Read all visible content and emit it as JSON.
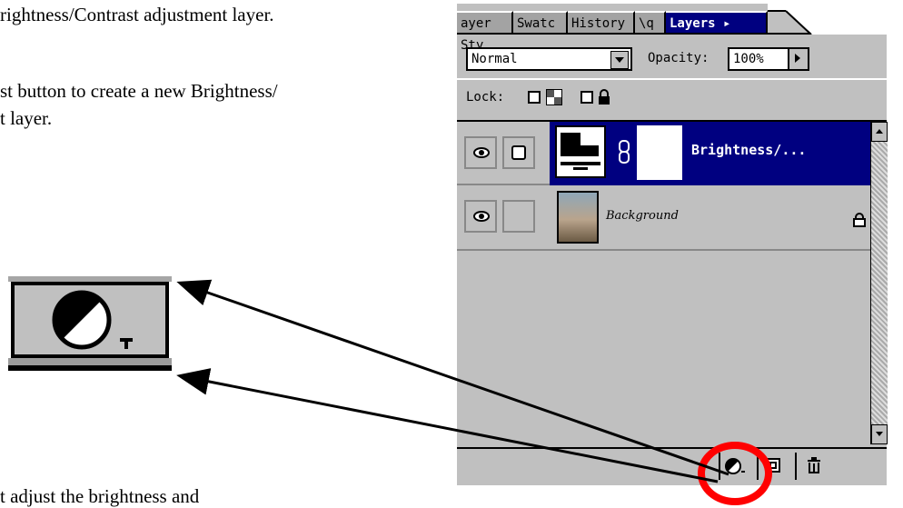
{
  "doc": {
    "line1": "rightness/Contrast adjustment layer.",
    "line2": "st button to create a new Brightness/",
    "line3": "t layer.",
    "line4": "t adjust the brightness and"
  },
  "panel": {
    "tabs": [
      "ayer Sty",
      "Swatc",
      "History",
      "\\q",
      "Layers ▸"
    ],
    "blend_mode": "Normal",
    "opacity_label": "Opacity:",
    "opacity_value": "100%",
    "lock_label": "Lock:",
    "layers": [
      {
        "name": "Brightness/...",
        "selected": true
      },
      {
        "name": "Background",
        "selected": false
      }
    ]
  }
}
